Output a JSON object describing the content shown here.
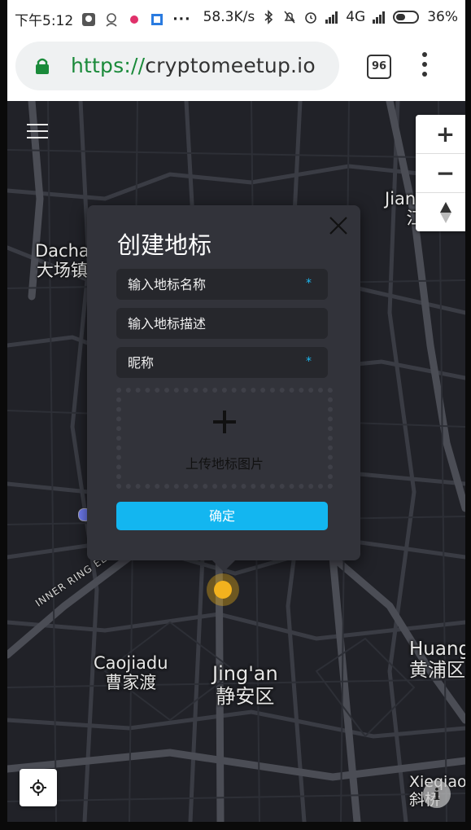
{
  "status_bar": {
    "time": "下午5:12",
    "network_speed": "58.3K/s",
    "network_type": "4G",
    "battery": "36%"
  },
  "browser": {
    "url_scheme": "https://",
    "url_host": "cryptomeetup.io",
    "tab_count": "96"
  },
  "map": {
    "places": [
      {
        "en": "Dacha",
        "zh": "大场镇"
      },
      {
        "en": "Jiangwan",
        "zh": "江湾"
      },
      {
        "en": "Caojiadu",
        "zh": "曹家渡"
      },
      {
        "en": "Jing'an",
        "zh": "静安区"
      },
      {
        "en": "Huangpu",
        "zh": "黄浦区"
      },
      {
        "en": "Xieqiao",
        "zh": "斜桥"
      }
    ],
    "road_label": "INNER RING ELEVATED RD",
    "zoom_in": "+",
    "zoom_out": "−",
    "info": "i"
  },
  "dialog": {
    "title": "创建地标",
    "name_placeholder": "输入地标名称",
    "desc_placeholder": "输入地标描述",
    "nickname_placeholder": "昵称",
    "required_mark": "*",
    "upload_label": "上传地标图片",
    "confirm_label": "确定"
  },
  "colors": {
    "accent": "#13b6f0",
    "marker": "#f2b21e",
    "map_bg": "#212228",
    "dialog_bg": "#32333a"
  }
}
